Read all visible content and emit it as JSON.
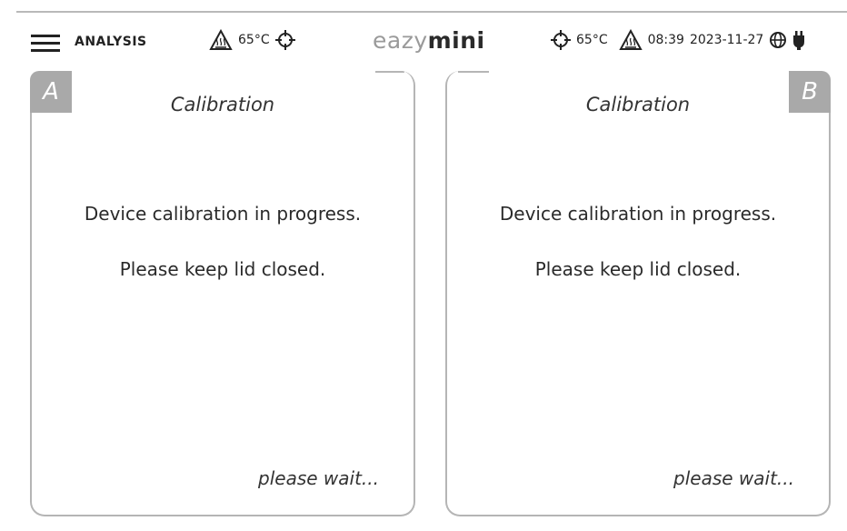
{
  "header": {
    "title": "ANALYSIS",
    "logo_part1": "eazy",
    "logo_part2": "mini",
    "left_temp": "65°C",
    "right_temp": "65°C",
    "time": "08:39",
    "date": "2023-11-27",
    "icons": [
      "menu-icon",
      "heat-warning-icon",
      "target-icon",
      "globe-icon",
      "plug-icon"
    ]
  },
  "panels": [
    {
      "badge": "A",
      "title": "Calibration",
      "message1": "Device calibration in progress.",
      "message2": "Please keep lid closed.",
      "status": "please wait..."
    },
    {
      "badge": "B",
      "title": "Calibration",
      "message1": "Device calibration in progress.",
      "message2": "Please keep lid closed.",
      "status": "please wait..."
    }
  ],
  "colors": {
    "frame": "#b5b5b5",
    "badge": "#a9a9a9",
    "text": "#2a2a2a"
  }
}
